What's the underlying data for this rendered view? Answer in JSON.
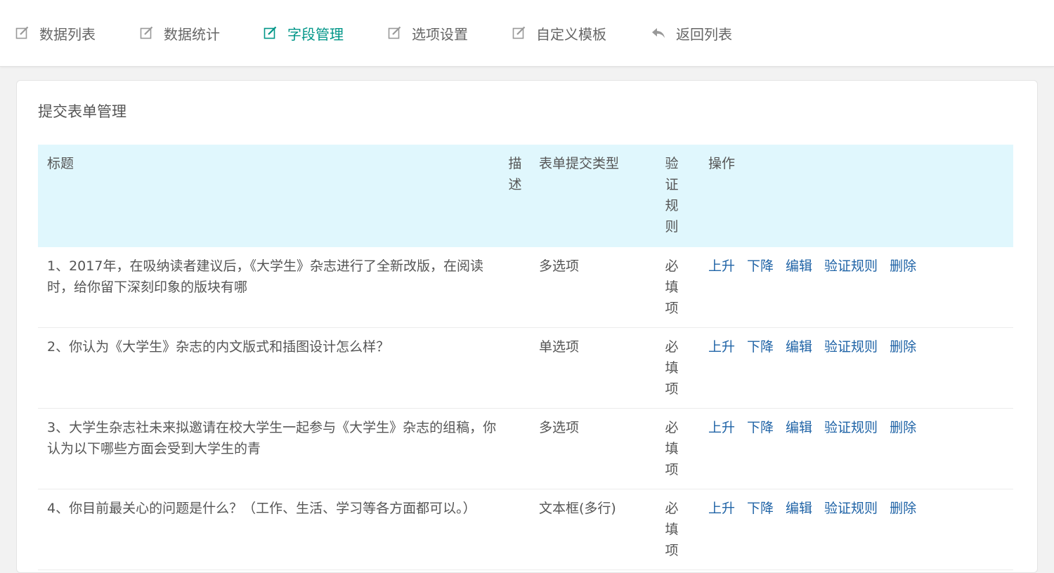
{
  "nav": {
    "items": [
      {
        "label": "数据列表",
        "active": false,
        "icon": "edit-icon"
      },
      {
        "label": "数据统计",
        "active": false,
        "icon": "edit-icon"
      },
      {
        "label": "字段管理",
        "active": true,
        "icon": "edit-icon"
      },
      {
        "label": "选项设置",
        "active": false,
        "icon": "edit-icon"
      },
      {
        "label": "自定义模板",
        "active": false,
        "icon": "edit-icon"
      },
      {
        "label": "返回列表",
        "active": false,
        "icon": "reply-icon"
      }
    ]
  },
  "panel": {
    "title": "提交表单管理"
  },
  "table": {
    "headers": {
      "title": "标题",
      "desc": "描述",
      "type": "表单提交类型",
      "rule": "验证规则",
      "actions": "操作"
    },
    "rows": [
      {
        "title": "1、2017年，在吸纳读者建议后，《大学生》杂志进行了全新改版，在阅读时，给你留下深刻印象的版块有哪",
        "desc": "",
        "type": "多选项",
        "rule": "必填项"
      },
      {
        "title": "2、你认为《大学生》杂志的内文版式和插图设计怎么样？",
        "desc": "",
        "type": "单选项",
        "rule": "必填项"
      },
      {
        "title": "3、大学生杂志社未来拟邀请在校大学生一起参与《大学生》杂志的组稿，你认为以下哪些方面会受到大学生的青",
        "desc": "",
        "type": "多选项",
        "rule": "必填项"
      },
      {
        "title": "4、你目前最关心的问题是什么？（工作、生活、学习等各方面都可以。）",
        "desc": "",
        "type": "文本框(多行)",
        "rule": "必填项"
      }
    ],
    "actions": [
      "上升",
      "下降",
      "编辑",
      "验证规则",
      "删除"
    ]
  },
  "colors": {
    "active": "#009688",
    "link": "#1f63a6",
    "header_bg": "#e0f7fd"
  }
}
